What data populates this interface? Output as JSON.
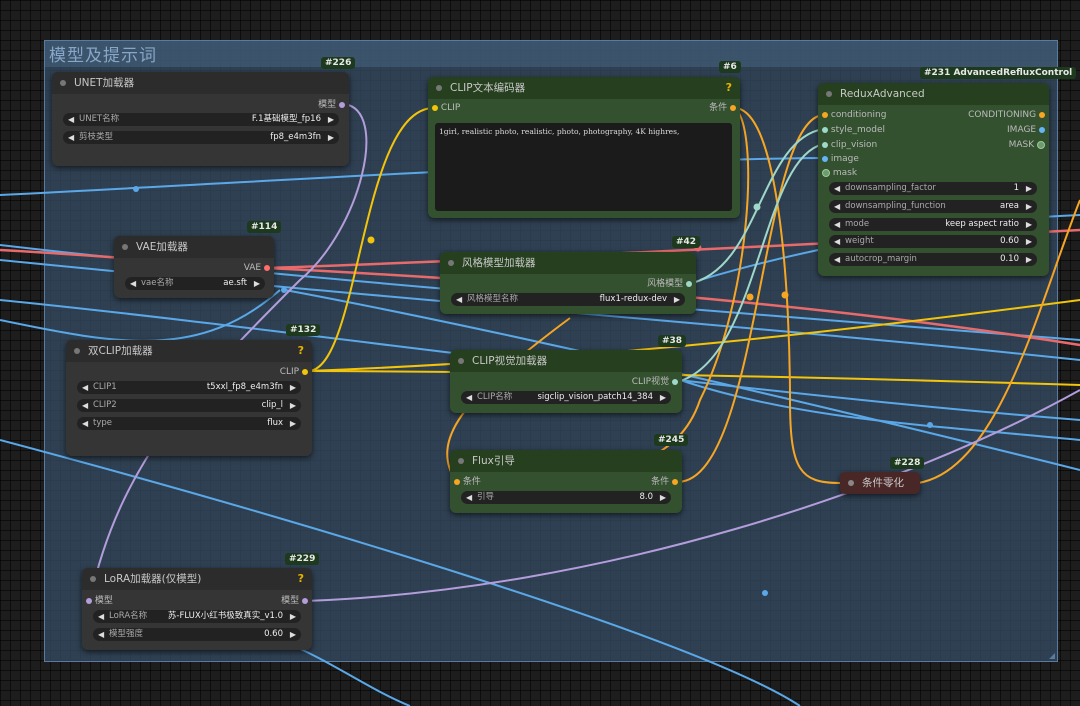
{
  "group": {
    "title": "模型及提示词"
  },
  "colors": {
    "clip": "#f2c40a",
    "conditioning": "#f6a623",
    "model": "#b39ddb",
    "vae": "#ff6e6e",
    "image": "#64b5f6",
    "clip_vision": "#a8dadc"
  },
  "nodes": {
    "unet": {
      "id": "#226",
      "title": "UNET加载器",
      "output": "模型",
      "widgets": [
        {
          "label": "UNET名称",
          "value": "F.1基础模型_fp16"
        },
        {
          "label": "剪枝类型",
          "value": "fp8_e4m3fn"
        }
      ]
    },
    "clip_encode": {
      "id": "#6",
      "title": "CLIP文本编码器",
      "input": "CLIP",
      "output": "条件",
      "text": "1girl, realistic photo, realistic, photo, photography, 4K highres,"
    },
    "redux": {
      "id": "#231 AdvancedRefluxControl",
      "title": "ReduxAdvanced",
      "inputs": [
        "conditioning",
        "style_model",
        "clip_vision",
        "image",
        "mask"
      ],
      "outputs": [
        "CONDITIONING",
        "IMAGE",
        "MASK"
      ],
      "widgets": [
        {
          "label": "downsampling_factor",
          "value": "1"
        },
        {
          "label": "downsampling_function",
          "value": "area"
        },
        {
          "label": "mode",
          "value": "keep aspect ratio"
        },
        {
          "label": "weight",
          "value": "0.60"
        },
        {
          "label": "autocrop_margin",
          "value": "0.10"
        }
      ]
    },
    "vae": {
      "id": "#114",
      "title": "VAE加载器",
      "output": "VAE",
      "widgets": [
        {
          "label": "vae名称",
          "value": "ae.sft"
        }
      ]
    },
    "style": {
      "id": "#42",
      "title": "风格模型加载器",
      "output": "风格模型",
      "widgets": [
        {
          "label": "风格模型名称",
          "value": "flux1-redux-dev"
        }
      ]
    },
    "dualclip": {
      "id": "#132",
      "title": "双CLIP加载器",
      "output": "CLIP",
      "widgets": [
        {
          "label": "CLIP1",
          "value": "t5xxl_fp8_e4m3fn"
        },
        {
          "label": "CLIP2",
          "value": "clip_l"
        },
        {
          "label": "type",
          "value": "flux"
        }
      ]
    },
    "clipvision": {
      "id": "#38",
      "title": "CLIP视觉加载器",
      "output": "CLIP视觉",
      "widgets": [
        {
          "label": "CLIP名称",
          "value": "sigclip_vision_patch14_384"
        }
      ]
    },
    "flux": {
      "id": "#245",
      "title": "Flux引导",
      "input": "条件",
      "output": "条件",
      "widgets": [
        {
          "label": "引导",
          "value": "8.0"
        }
      ]
    },
    "zero": {
      "id": "#228",
      "title": "条件零化"
    },
    "lora": {
      "id": "#229",
      "title": "LoRA加载器(仅模型)",
      "input": "模型",
      "output": "模型",
      "widgets": [
        {
          "label": "LoRA名称",
          "value": "苏-FLUX小红书极致真实_v1.0"
        },
        {
          "label": "模型强度",
          "value": "0.60"
        }
      ]
    }
  }
}
